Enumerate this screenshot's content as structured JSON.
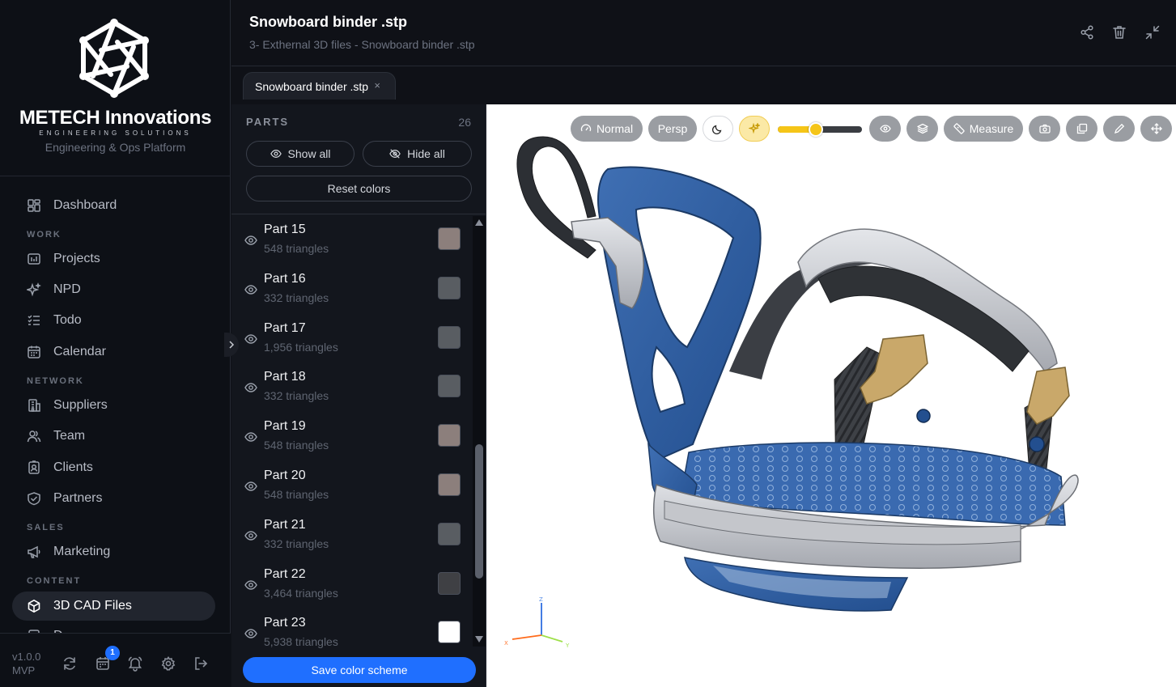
{
  "brand": {
    "name": "METECH Innovations",
    "tagline": "ENGINEERING SOLUTIONS",
    "subtitle": "Engineering & Ops Platform"
  },
  "nav": {
    "dashboard": "Dashboard",
    "section_work": "WORK",
    "projects": "Projects",
    "npd": "NPD",
    "todo": "Todo",
    "calendar": "Calendar",
    "section_network": "NETWORK",
    "suppliers": "Suppliers",
    "team": "Team",
    "clients": "Clients",
    "partners": "Partners",
    "section_sales": "SALES",
    "marketing": "Marketing",
    "section_content": "CONTENT",
    "cad_files": "3D CAD Files",
    "partial_next": "D"
  },
  "footer": {
    "version": "v1.0.0",
    "release": "MVP",
    "notification_count": "1"
  },
  "file": {
    "title": "Snowboard binder .stp",
    "path": "3- Exthernal 3D files - Snowboard binder .stp",
    "tab_label": "Snowboard binder .stp",
    "tab_close": "×"
  },
  "parts": {
    "title": "PARTS",
    "count": "26",
    "show_all": "Show all",
    "hide_all": "Hide all",
    "reset_colors": "Reset colors",
    "save_scheme": "Save color scheme",
    "items": [
      {
        "name": "Part 15",
        "triangles": "548 triangles",
        "color": "#8c7f7c"
      },
      {
        "name": "Part 16",
        "triangles": "332 triangles",
        "color": "#595d62"
      },
      {
        "name": "Part 17",
        "triangles": "1,956 triangles",
        "color": "#595d62"
      },
      {
        "name": "Part 18",
        "triangles": "332 triangles",
        "color": "#595d62"
      },
      {
        "name": "Part 19",
        "triangles": "548 triangles",
        "color": "#8c7f7c"
      },
      {
        "name": "Part 20",
        "triangles": "548 triangles",
        "color": "#8c7f7c"
      },
      {
        "name": "Part 21",
        "triangles": "332 triangles",
        "color": "#595d62"
      },
      {
        "name": "Part 22",
        "triangles": "3,464 triangles",
        "color": "#3f4044"
      },
      {
        "name": "Part 23",
        "triangles": "5,938 triangles",
        "color": "#ffffff"
      }
    ]
  },
  "viewer": {
    "mode_normal": "Normal",
    "mode_persp": "Persp",
    "measure": "Measure",
    "slider_value": 0.45,
    "axis_x": "X",
    "axis_y": "Y",
    "axis_z": "Z",
    "accent": "#f5c518"
  }
}
